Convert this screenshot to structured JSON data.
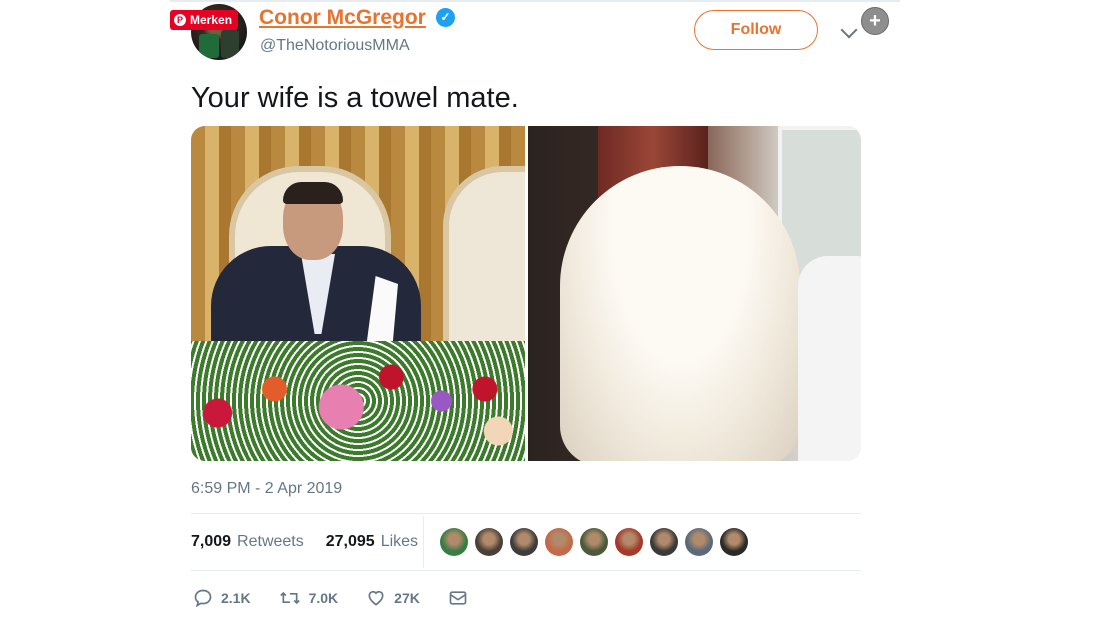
{
  "badge": {
    "label": "Merken"
  },
  "author": {
    "name": "Conor McGregor",
    "handle": "@TheNotoriousMMA",
    "verified_mark": "✓"
  },
  "follow": {
    "label": "Follow"
  },
  "tweet": {
    "text": "Your wife is a towel mate.",
    "timestamp": "6:59 PM - 2 Apr 2019"
  },
  "stats": {
    "retweets_count": "7,009",
    "retweets_label": "Retweets",
    "likes_count": "27,095",
    "likes_label": "Likes"
  },
  "likers": [
    "#3a7d44",
    "#4b4038",
    "#3d3d3d",
    "#c46a4a",
    "#4a5a3a",
    "#a33a2a",
    "#3a3a3a",
    "#5a6a7a",
    "#2a2a2a"
  ],
  "actions": {
    "reply_count": "2.1K",
    "retweet_count": "7.0K",
    "like_count": "27K"
  },
  "colors": {
    "accent": "#e8732e",
    "muted": "#657786",
    "verified": "#1da1f2",
    "pinterest": "#e60023"
  },
  "icons": [
    "pinterest-icon",
    "verified-icon",
    "chevron-down-icon",
    "plus-icon",
    "reply-icon",
    "retweet-icon",
    "like-icon",
    "message-icon"
  ]
}
